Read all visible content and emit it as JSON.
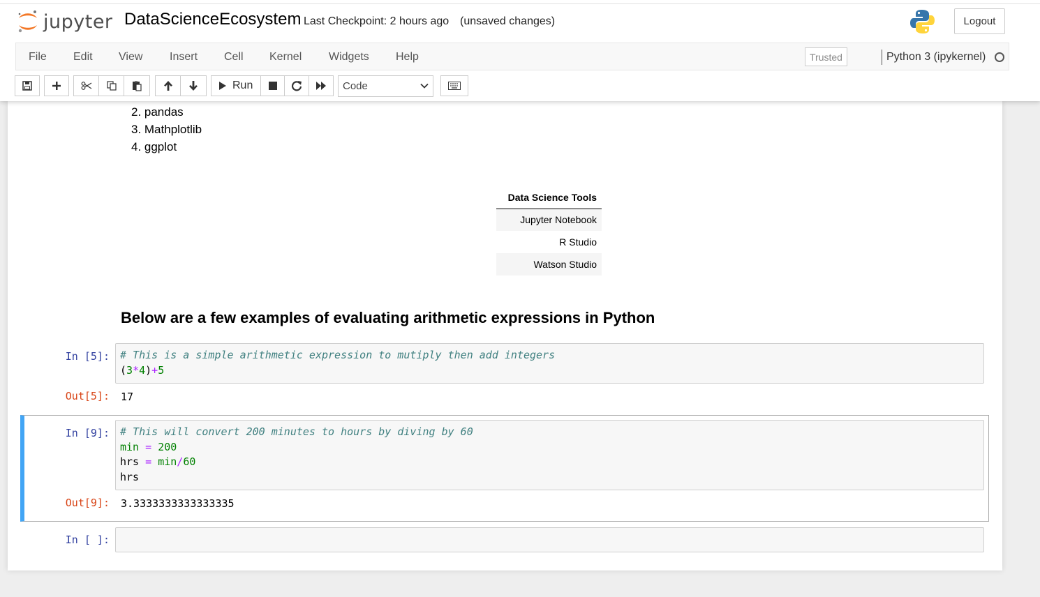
{
  "header": {
    "logo_text": "jupyter",
    "notebook_name": "DataScienceEcosystem",
    "checkpoint": "Last Checkpoint: 2 hours ago",
    "unsaved": "(unsaved changes)",
    "logout_label": "Logout"
  },
  "menubar": {
    "items": [
      "File",
      "Edit",
      "View",
      "Insert",
      "Cell",
      "Kernel",
      "Widgets",
      "Help"
    ],
    "trusted": "Trusted",
    "kernel_name": "Python 3 (ipykernel)"
  },
  "toolbar": {
    "run_label": "Run",
    "cell_type": "Code"
  },
  "markdown": {
    "list_items": [
      "2. pandas",
      "3. Mathplotlib",
      "4. ggplot"
    ],
    "table": {
      "header": "Data Science Tools",
      "rows": [
        "Jupyter Notebook",
        "R Studio",
        "Watson Studio"
      ]
    },
    "heading": "Below are a few examples of evaluating arithmetic expressions in Python"
  },
  "cells": {
    "c5": {
      "in_prompt": "In [5]:",
      "comment": "# This is a simple arithmetic expression to mutiply then add integers",
      "code": {
        "p1": "(",
        "n1": "3",
        "o1": "*",
        "n2": "4",
        "p2": ")",
        "o2": "+",
        "n3": "5"
      },
      "out_prompt": "Out[5]:",
      "output": "17"
    },
    "c9": {
      "in_prompt": "In [9]:",
      "comment": "# This will convert 200 minutes to hours by diving by 60",
      "line2": {
        "v": "min",
        "eq": " = ",
        "n": "200"
      },
      "line3": {
        "v": "hrs",
        "eq": " = ",
        "v2": "min",
        "op": "/",
        "n": "60"
      },
      "line4": "hrs",
      "out_prompt": "Out[9]:",
      "output": "3.3333333333333335"
    },
    "empty": {
      "in_prompt": "In [ ]:"
    }
  },
  "colors": {
    "selected_cell_bar": "#42a5f5",
    "in_prompt": "#303f9f",
    "out_prompt": "#d84315",
    "comment": "#408080"
  }
}
